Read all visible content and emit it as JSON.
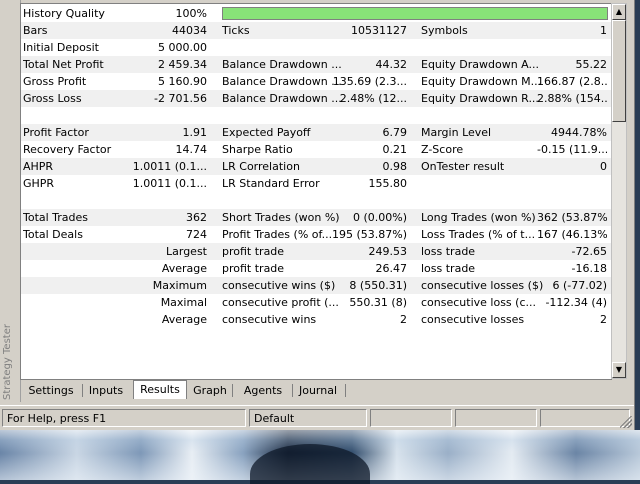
{
  "sidebar": {
    "title": "Strategy Tester"
  },
  "colors": {
    "quality_bar": "#88e278"
  },
  "history_quality": {
    "label": "History Quality",
    "value": "100%",
    "fill_fraction": 1.0
  },
  "rows": [
    {
      "c1": "Bars",
      "c2": "44034",
      "c3": "Ticks",
      "c4": "10531127",
      "c5": "Symbols",
      "c6": "1"
    },
    {
      "c1": "Initial Deposit",
      "c2": "5 000.00",
      "c3": "",
      "c4": "",
      "c5": "",
      "c6": ""
    },
    {
      "c1": "Total Net Profit",
      "c2": "2 459.34",
      "c3": "Balance Drawdown ...",
      "c4": "44.32",
      "c5": "Equity Drawdown A...",
      "c6": "55.22"
    },
    {
      "c1": "Gross Profit",
      "c2": "5 160.90",
      "c3": "Balance Drawdown ...",
      "c4": "135.69 (2.3...",
      "c5": "Equity Drawdown M...",
      "c6": "166.87 (2.8..."
    },
    {
      "c1": "Gross Loss",
      "c2": "-2 701.56",
      "c3": "Balance Drawdown ...",
      "c4": "2.48% (12...",
      "c5": "Equity Drawdown R...",
      "c6": "2.88% (154..."
    },
    {
      "c1": "",
      "c2": "",
      "c3": "",
      "c4": "",
      "c5": "",
      "c6": ""
    },
    {
      "c1": "Profit Factor",
      "c2": "1.91",
      "c3": "Expected Payoff",
      "c4": "6.79",
      "c5": "Margin Level",
      "c6": "4944.78%"
    },
    {
      "c1": "Recovery Factor",
      "c2": "14.74",
      "c3": "Sharpe Ratio",
      "c4": "0.21",
      "c5": "Z-Score",
      "c6": "-0.15 (11.9..."
    },
    {
      "c1": "AHPR",
      "c2": "1.0011 (0.1...",
      "c3": "LR Correlation",
      "c4": "0.98",
      "c5": "OnTester result",
      "c6": "0"
    },
    {
      "c1": "GHPR",
      "c2": "1.0011 (0.1...",
      "c3": "LR Standard Error",
      "c4": "155.80",
      "c5": "",
      "c6": ""
    },
    {
      "c1": "",
      "c2": "",
      "c3": "",
      "c4": "",
      "c5": "",
      "c6": ""
    },
    {
      "c1": "Total Trades",
      "c2": "362",
      "c3": "Short Trades (won %)",
      "c4": "0 (0.00%)",
      "c5": "Long Trades (won %)",
      "c6": "362 (53.87%)"
    },
    {
      "c1": "Total Deals",
      "c2": "724",
      "c3": "Profit Trades (% of...",
      "c4": "195 (53.87%)",
      "c5": "Loss Trades (% of t...",
      "c6": "167 (46.13%)"
    },
    {
      "c1r": "Largest",
      "c3": "profit trade",
      "c4": "249.53",
      "c5": "loss trade",
      "c6": "-72.65"
    },
    {
      "c1r": "Average",
      "c3": "profit trade",
      "c4": "26.47",
      "c5": "loss trade",
      "c6": "-16.18"
    },
    {
      "c1r": "Maximum",
      "c3": "consecutive wins ($)",
      "c4": "8 (550.31)",
      "c5": "consecutive losses ($)",
      "c6": "6 (-77.02)"
    },
    {
      "c1r": "Maximal",
      "c3": "consecutive profit (...",
      "c4": "550.31 (8)",
      "c5": "consecutive loss (c...",
      "c6": "-112.34 (4)"
    },
    {
      "c1r": "Average",
      "c3": "consecutive wins",
      "c4": "2",
      "c5": "consecutive losses",
      "c6": "2"
    }
  ],
  "tabs": [
    {
      "label": "Settings",
      "active": false
    },
    {
      "label": "Inputs",
      "active": false
    },
    {
      "label": "Results",
      "active": true
    },
    {
      "label": "Graph",
      "active": false
    },
    {
      "label": "Agents",
      "active": false
    },
    {
      "label": "Journal",
      "active": false
    }
  ],
  "scrollbar": {
    "up_icon": "arrow-up-icon",
    "down_icon": "arrow-down-icon"
  },
  "status": {
    "help": "For Help, press F1",
    "profile": "Default"
  }
}
